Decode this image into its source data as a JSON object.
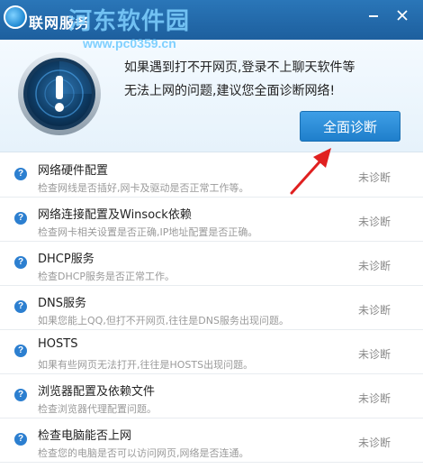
{
  "window": {
    "title": "联网服务",
    "watermark": {
      "name": "河东软件园",
      "url": "www.pc0359.cn"
    }
  },
  "header": {
    "message_line1": "如果遇到打不开网页,登录不上聊天软件等",
    "message_line2": "无法上网的问题,建议您全面诊断网络!",
    "diagnose_button": "全面诊断"
  },
  "items": [
    {
      "title": "网络硬件配置",
      "desc": "检查网线是否插好,网卡及驱动是否正常工作等。",
      "status": "未诊断"
    },
    {
      "title": "网络连接配置及Winsock依赖",
      "desc": "检查网卡相关设置是否正确,IP地址配置是否正确。",
      "status": "未诊断"
    },
    {
      "title": "DHCP服务",
      "desc": "检查DHCP服务是否正常工作。",
      "status": "未诊断"
    },
    {
      "title": "DNS服务",
      "desc": "如果您能上QQ,但打不开网页,往往是DNS服务出现问题。",
      "status": "未诊断"
    },
    {
      "title": "HOSTS",
      "desc": "如果有些网页无法打开,往往是HOSTS出现问题。",
      "status": "未诊断"
    },
    {
      "title": "浏览器配置及依赖文件",
      "desc": "检查浏览器代理配置问题。",
      "status": "未诊断"
    },
    {
      "title": "检查电脑能否上网",
      "desc": "检查您的电脑是否可以访问网页,网络是否连通。",
      "status": "未诊断"
    }
  ],
  "colors": {
    "titlebar": "#2a76b8",
    "accent": "#2c7fd0",
    "button": "#2b8bd8",
    "arrow": "#e02020"
  },
  "icons": {
    "app": "app-logo-icon",
    "warning": "exclamation-radar-icon",
    "item": "question-icon",
    "minimize": "minimize-icon",
    "close": "close-icon",
    "arrow": "red-arrow-annotation"
  }
}
